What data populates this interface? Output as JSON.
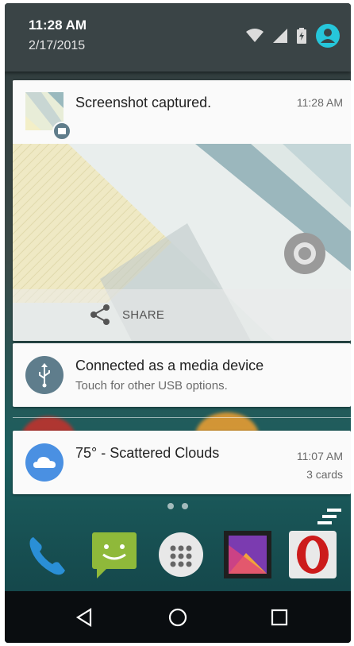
{
  "status_bar": {
    "time": "11:28 AM",
    "date": "2/17/2015",
    "icons": [
      "wifi-icon",
      "signal-icon",
      "battery-charging-icon",
      "user-avatar-icon"
    ]
  },
  "notifications": {
    "screenshot": {
      "title": "Screenshot captured.",
      "time": "11:28 AM",
      "action_label": "SHARE",
      "icon": "image-icon"
    },
    "usb": {
      "title": "Connected as a media device",
      "subtitle": "Touch for other USB options.",
      "icon": "usb-icon"
    },
    "weather": {
      "title": "75° - Scattered Clouds",
      "time": "11:07 AM",
      "cards": "3 cards",
      "icon": "cloud-icon"
    }
  },
  "home": {
    "dock_apps": [
      "phone-icon",
      "messaging-icon",
      "app-drawer-icon",
      "gallery-icon",
      "opera-icon"
    ]
  },
  "nav": {
    "buttons": [
      "back-icon",
      "home-icon",
      "recents-icon"
    ]
  },
  "colors": {
    "statusbar": "#3a4446",
    "accent_teal": "#26c6da",
    "usb_circle": "#5f7d8c",
    "weather_circle": "#4a90e2"
  }
}
